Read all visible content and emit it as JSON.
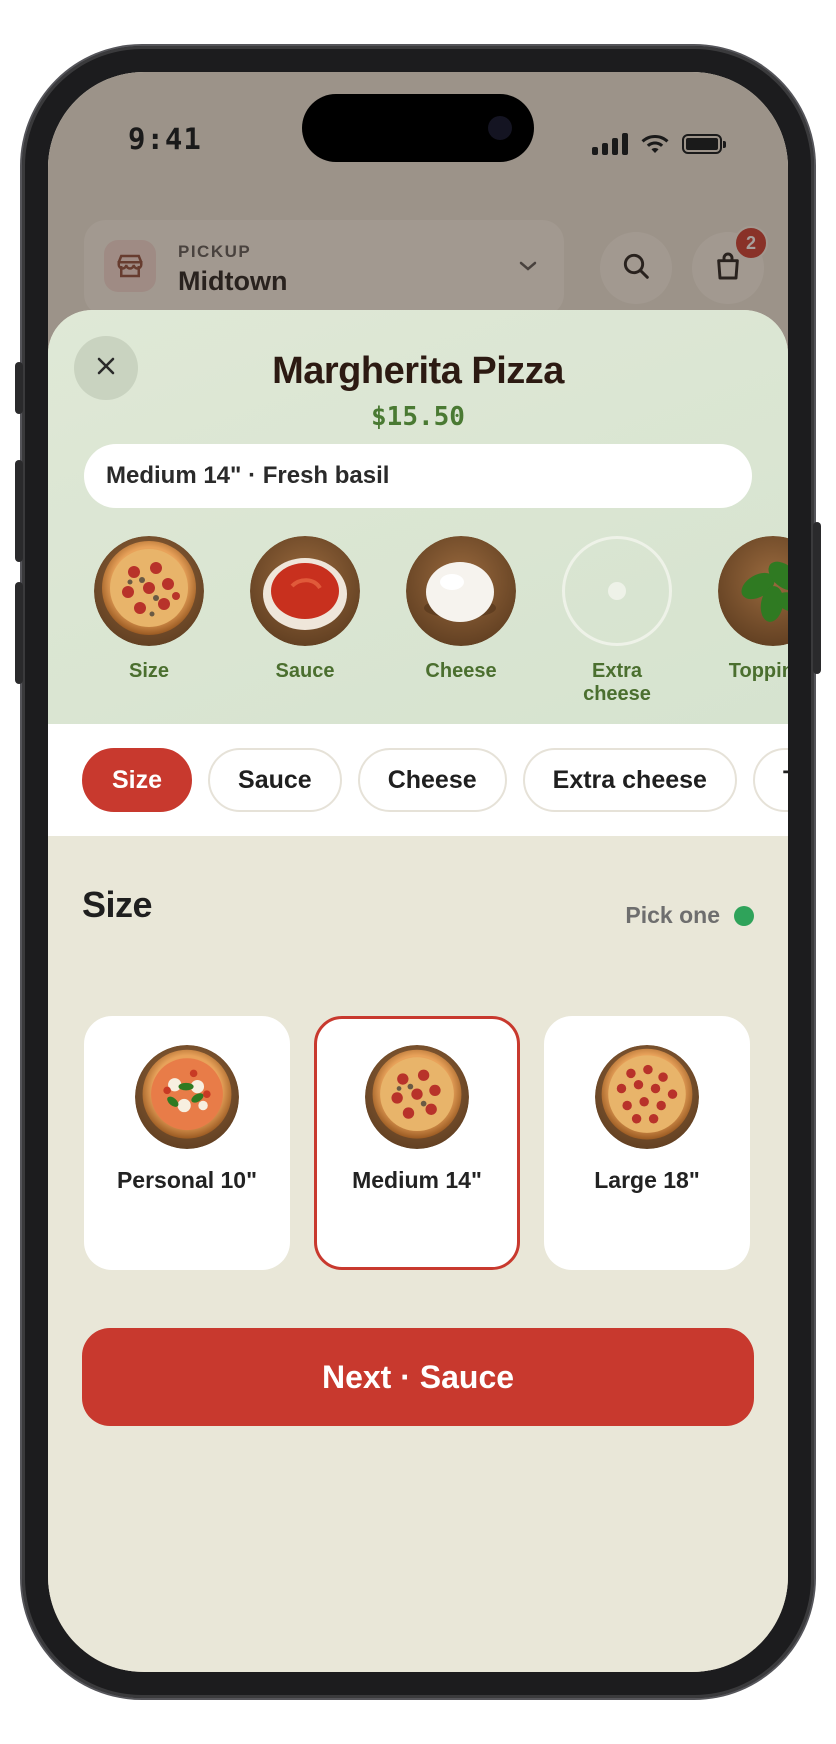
{
  "status_bar": {
    "time": "9:41"
  },
  "background": {
    "pickup_label": "PICKUP",
    "pickup_location": "Midtown",
    "cart_count": "2"
  },
  "sheet": {
    "title": "Margherita Pizza",
    "price": "$15.50",
    "summary": "Medium 14\" · Fresh basil",
    "steps": [
      {
        "label": "Size",
        "image": "pepperoni-pizza"
      },
      {
        "label": "Sauce",
        "image": "tomato-sauce-bowl"
      },
      {
        "label": "Cheese",
        "image": "mozzarella-ball"
      },
      {
        "label": "Extra cheese",
        "image": "empty-placeholder"
      },
      {
        "label": "Toppings",
        "image": "basil-leaves"
      }
    ],
    "chips": [
      "Size",
      "Sauce",
      "Cheese",
      "Extra cheese",
      "Toppings"
    ],
    "active_chip": "Size",
    "section": {
      "title": "Size",
      "hint": "Pick one",
      "options": [
        {
          "label": "Personal 10\"",
          "image": "margherita-pizza"
        },
        {
          "label": "Medium 14\"",
          "image": "pepperoni-pizza",
          "selected": true
        },
        {
          "label": "Large 18\"",
          "image": "pepperoni-pizza-large"
        }
      ]
    },
    "next_button": "Next · Sauce"
  },
  "colors": {
    "accent": "#c8392e",
    "green_text": "#4b6f2f",
    "status_dot": "#2fa35a",
    "sheet_bg": "#e9e7d8",
    "header_bg": "#d6e3cf"
  }
}
